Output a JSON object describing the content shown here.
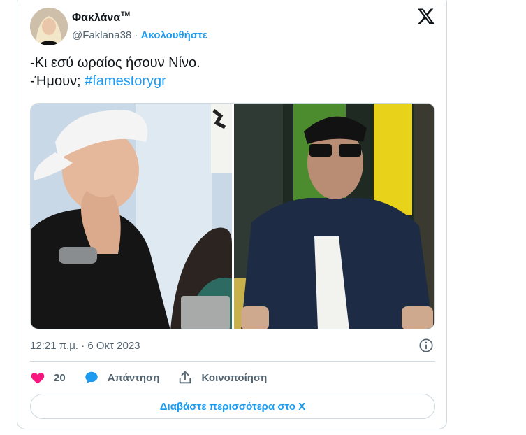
{
  "tweet": {
    "author_name": "Φακλάνα",
    "author_suffix": "TM",
    "handle": "@Faklana38",
    "separator": "·",
    "follow_label": "Ακολουθήστε",
    "line1": "-Κι εσύ ωραίος ήσουν Νίνο.",
    "line2_prefix": "-Ήμουν; ",
    "hashtag": "#famestorygr",
    "timestamp": "12:21 π.μ. · 6 Οκτ 2023",
    "likes": "20",
    "reply_label": "Απάντηση",
    "share_label": "Κοινοποίηση",
    "read_more_label": "Διαβάστε περισσότερα στο X"
  },
  "icons": {
    "platform": "x-logo-icon",
    "info": "info-icon",
    "like": "heart-icon",
    "reply": "reply-bubble-icon",
    "share": "share-upload-icon"
  },
  "colors": {
    "accent": "#1d9bf0",
    "like": "#f91880",
    "secondary_text": "#536471",
    "border": "#cfd9de"
  }
}
